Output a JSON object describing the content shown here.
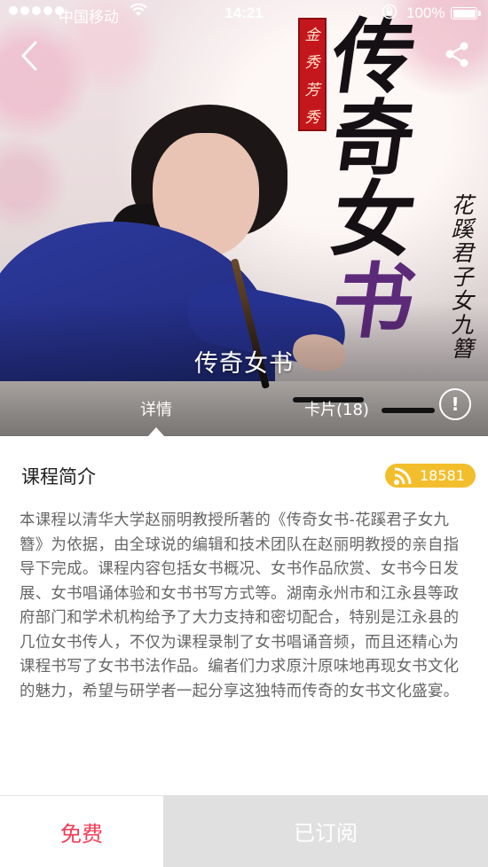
{
  "status_bar": {
    "carrier": "中国移动",
    "time": "14:21",
    "battery": "100%",
    "battery_level": 1.0
  },
  "cover": {
    "seal_text": [
      "金",
      "秀",
      "芳",
      "秀"
    ],
    "calligraphy_title": [
      "传",
      "奇",
      "女",
      "书"
    ],
    "calligraphy_subtitle": [
      "花",
      "蹊",
      "君",
      "子",
      "女",
      "九",
      "簪"
    ]
  },
  "header": {
    "title": "传奇女书"
  },
  "tabs": [
    {
      "label": "详情",
      "selected": true
    },
    {
      "label": "卡片(18)",
      "selected": false
    }
  ],
  "intro": {
    "heading": "课程简介",
    "subscriber_count": "18581",
    "description": "本课程以清华大学赵丽明教授所著的《传奇女书-花蹊君子女九簪》为依据，由全球说的编辑和技术团队在赵丽明教授的亲自指导下完成。课程内容包括女书概况、女书作品欣赏、女书今日发展、女书唱诵体验和女书书写方式等。湖南永州市和江永县等政府部门和学术机构给予了大力支持和密切配合，特别是江永县的几位女书传人，不仅为课程录制了女书唱诵音频，而且还精心为课程书写了女书书法作品。编者们力求原汁原味地再现女书文化的魅力，希望与研学者一起分享这独特而传奇的女书文化盛宴。"
  },
  "actions": {
    "free_label": "免费",
    "subscribed_label": "已订阅"
  },
  "colors": {
    "badge": "#f3be2c",
    "free_text": "#f03c56",
    "subscribed_bg": "#e0e0e0"
  },
  "icons": {
    "back": "chevron-left-icon",
    "share": "share-icon",
    "info": "info-icon",
    "rss": "rss-icon",
    "wifi": "wifi-icon",
    "lock": "rotation-lock-icon"
  }
}
